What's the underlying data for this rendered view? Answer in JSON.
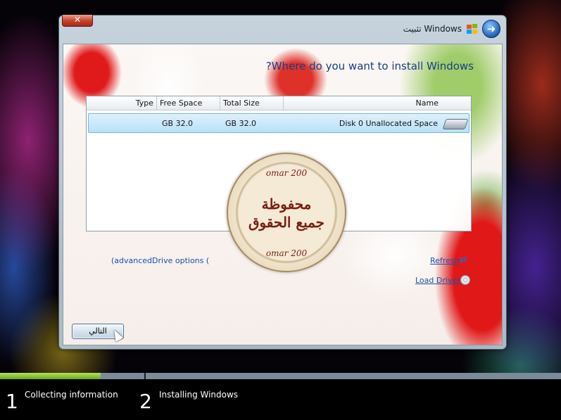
{
  "window": {
    "title": "تثبيت Windows",
    "close_label": "✕"
  },
  "content": {
    "heading": "?Where do you want to install Windows",
    "columns": [
      "Type",
      "Free Space",
      "Total Size",
      "Name"
    ],
    "disks": [
      {
        "type": "",
        "free_space": "GB 32.0",
        "total_size": "GB 32.0",
        "name": "Disk 0 Unallocated Space"
      }
    ],
    "advanced_link": "(advancedDrive options (",
    "refresh_link": "Refresh",
    "load_driver_link": "Load Driver",
    "next_button": "التالي"
  },
  "watermark": {
    "top": "omar 200",
    "center_line1": "محفوظة",
    "center_line2": "جميع الحقوق",
    "bottom": "omar 200"
  },
  "icons": {
    "back": "back-arrow-icon",
    "flag": "windows-flag-icon",
    "drive": "hard-drive-icon",
    "refresh": "refresh-icon",
    "cd": "cd-icon",
    "cursor": "mouse-cursor-icon"
  },
  "progress": {
    "fraction": 0.18,
    "steps": [
      {
        "number": "1",
        "label": "Collecting information"
      },
      {
        "number": "2",
        "label": "Installing Windows"
      }
    ]
  },
  "colors": {
    "accent": "#1a52a8",
    "progress_fill": "#6aa61c",
    "selection": "#b9e0f7"
  }
}
